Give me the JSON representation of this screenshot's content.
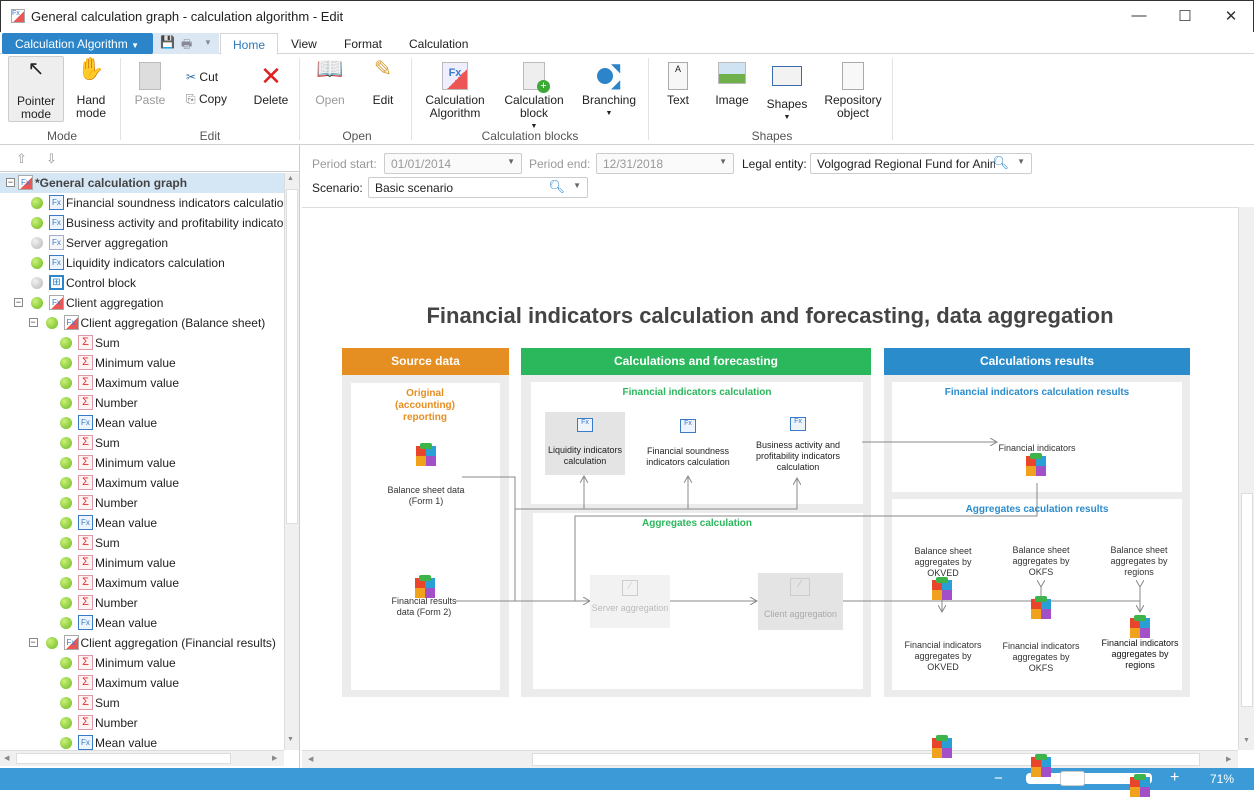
{
  "window": {
    "title": "General calculation graph - calculation algorithm - Edit",
    "minimize": "—",
    "maximize": "☐",
    "close": "✕"
  },
  "ribbon": {
    "app_menu": "Calculation Algorithm",
    "tabs": [
      {
        "label": "Home",
        "active": true
      },
      {
        "label": "View"
      },
      {
        "label": "Format"
      },
      {
        "label": "Calculation"
      }
    ],
    "groups": {
      "mode": "Mode",
      "edit": "Edit",
      "open": "Open",
      "calc_blocks": "Calculation blocks",
      "shapes": "Shapes"
    },
    "buttons": {
      "pointer": "Pointer mode",
      "hand": "Hand mode",
      "paste": "Paste",
      "cut": "Cut",
      "copy": "Copy",
      "delete": "Delete",
      "open": "Open",
      "edit": "Edit",
      "calc_algorithm": "Calculation Algorithm",
      "calc_block": "Calculation block",
      "branching": "Branching",
      "text": "Text",
      "image": "Image",
      "shapes": "Shapes",
      "repository_object": "Repository object"
    }
  },
  "tree": {
    "items": [
      {
        "level": 0,
        "label": "*General calculation graph",
        "icon": "fxcolor",
        "expanded": true,
        "selected": true,
        "status": null
      },
      {
        "level": 1,
        "label": "Financial soundness indicators calculation",
        "icon": "fxstack",
        "status": "green"
      },
      {
        "level": 1,
        "label": "Business activity and profitability indicators calculation",
        "icon": "fxstack",
        "status": "green"
      },
      {
        "level": 1,
        "label": "Server aggregation",
        "icon": "fx",
        "status": "grey"
      },
      {
        "level": 1,
        "label": "Liquidity indicators calculation",
        "icon": "fxstack",
        "status": "green"
      },
      {
        "level": 1,
        "label": "Control block",
        "icon": "control",
        "status": "grey"
      },
      {
        "level": 1,
        "label": "Client aggregation",
        "icon": "fxcolor",
        "status": "green",
        "expanded": true
      },
      {
        "level": 2,
        "label": "Client aggregation (Balance sheet)",
        "icon": "fxcolor",
        "status": "green",
        "expanded": true
      },
      {
        "level": 3,
        "label": "Sum",
        "icon": "sigma",
        "status": "green"
      },
      {
        "level": 3,
        "label": "Minimum value",
        "icon": "sigma",
        "status": "green"
      },
      {
        "level": 3,
        "label": "Maximum value",
        "icon": "sigma",
        "status": "green"
      },
      {
        "level": 3,
        "label": "Number",
        "icon": "sigma",
        "status": "green"
      },
      {
        "level": 3,
        "label": "Mean value",
        "icon": "fxstack",
        "status": "green"
      },
      {
        "level": 3,
        "label": "Sum",
        "icon": "sigma",
        "status": "green"
      },
      {
        "level": 3,
        "label": "Minimum value",
        "icon": "sigma",
        "status": "green"
      },
      {
        "level": 3,
        "label": "Maximum value",
        "icon": "sigma",
        "status": "green"
      },
      {
        "level": 3,
        "label": "Number",
        "icon": "sigma",
        "status": "green"
      },
      {
        "level": 3,
        "label": "Mean value",
        "icon": "fxstack",
        "status": "green"
      },
      {
        "level": 3,
        "label": "Sum",
        "icon": "sigma",
        "status": "green"
      },
      {
        "level": 3,
        "label": "Minimum value",
        "icon": "sigma",
        "status": "green"
      },
      {
        "level": 3,
        "label": "Maximum value",
        "icon": "sigma",
        "status": "green"
      },
      {
        "level": 3,
        "label": "Number",
        "icon": "sigma",
        "status": "green"
      },
      {
        "level": 3,
        "label": "Mean value",
        "icon": "fxstack",
        "status": "green"
      },
      {
        "level": 2,
        "label": "Client aggregation (Financial results)",
        "icon": "fxcolor",
        "status": "green",
        "expanded": true
      },
      {
        "level": 3,
        "label": "Minimum value",
        "icon": "sigma",
        "status": "green"
      },
      {
        "level": 3,
        "label": "Maximum value",
        "icon": "sigma",
        "status": "green"
      },
      {
        "level": 3,
        "label": "Sum",
        "icon": "sigma",
        "status": "green"
      },
      {
        "level": 3,
        "label": "Number",
        "icon": "sigma",
        "status": "green"
      },
      {
        "level": 3,
        "label": "Mean value",
        "icon": "fxstack",
        "status": "green"
      }
    ]
  },
  "filters": {
    "period_start_label": "Period start:",
    "period_start": "01/01/2014",
    "period_end_label": "Period end:",
    "period_end": "12/31/2018",
    "legal_entity_label": "Legal entity:",
    "legal_entity": "Volgograd Regional Fund for Animal Welfare",
    "scenario_label": "Scenario:",
    "scenario": "Basic scenario"
  },
  "diagram": {
    "title": "Financial indicators calculation and forecasting, data aggregation",
    "colors": {
      "source": "#e58e22",
      "calc": "#2bb75c",
      "results": "#2b8ccc"
    },
    "source": {
      "header": "Source data",
      "subtitle": "Original (accounting) reporting",
      "balance": "Balance sheet data (Form 1)",
      "financial": "Financial results data (Form 2)"
    },
    "calc": {
      "header": "Calculations and forecasting",
      "fin_title": "Financial indicators calculation",
      "liquidity": "Liquidity indicators calculation",
      "soundness": "Financial soundness indicators calculation",
      "business": "Business activity and profitability indicators calculation",
      "agg_title": "Aggregates calculation",
      "server": "Server aggregation",
      "client": "Client aggregation"
    },
    "results": {
      "header": "Calculations results",
      "fin_title": "Financial indicators calculation results",
      "fin_ind": "Financial indicators",
      "agg_title": "Aggregates caculation results",
      "bs_okved": "Balance sheet aggregates by OKVED",
      "bs_okfs": "Balance sheet aggregates by OKFS",
      "bs_regions": "Balance sheet aggregates by regions",
      "fi_okved": "Financial indicators aggregates by OKVED",
      "fi_okfs": "Financial indicators aggregates by OKFS",
      "fi_regions": "Financial indicators aggregates by regions"
    }
  },
  "status": {
    "zoom_minus": "−",
    "zoom_plus": "+",
    "zoom": "71%",
    "zoom_level": 0.71
  }
}
